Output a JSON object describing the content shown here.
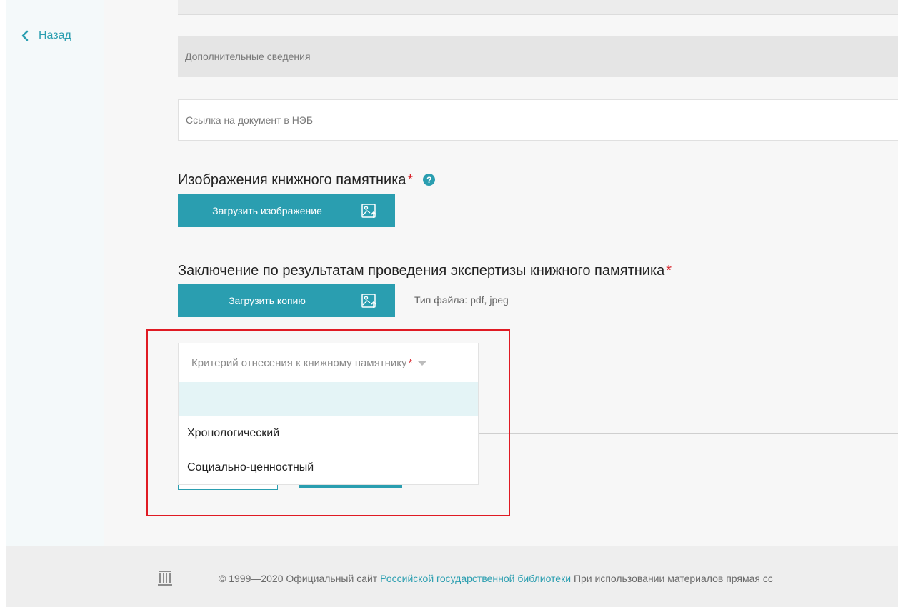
{
  "nav": {
    "back_label": "Назад"
  },
  "fields": {
    "additional_info_placeholder": "Дополнительные сведения",
    "neb_link_placeholder": "Ссылка на документ в НЭБ"
  },
  "images_section": {
    "title": "Изображения книжного памятника",
    "required_mark": "*",
    "help_icon_glyph": "?",
    "upload_button_label": "Загрузить изображение"
  },
  "expertise_section": {
    "title": "Заключение по результатам проведения экспертизы книжного памятника",
    "required_mark": "*",
    "upload_button_label": "Загрузить копию",
    "file_type_hint": "Тип файла: pdf, jpeg"
  },
  "criterion_select": {
    "placeholder": "Критерий отнесения к книжному памятнику",
    "required_mark": "*",
    "options": [
      "",
      "Хронологический",
      "Социально-ценностный"
    ]
  },
  "footer": {
    "copyright": "© 1999—2020 Официальный сайт",
    "library_link": "Российской государственной библиотеки",
    "usage_note": "При использовании материалов прямая сс"
  },
  "colors": {
    "accent": "#2a9eb0",
    "required": "#d9252c",
    "highlight_border": "#e01b24",
    "option_hover": "#e4f4f6"
  },
  "icons": {
    "back": "chevron-left-icon",
    "help": "question-circle-icon",
    "upload": "image-upload-icon",
    "dropdown": "caret-down-icon",
    "footer_logo": "library-logo-icon"
  }
}
